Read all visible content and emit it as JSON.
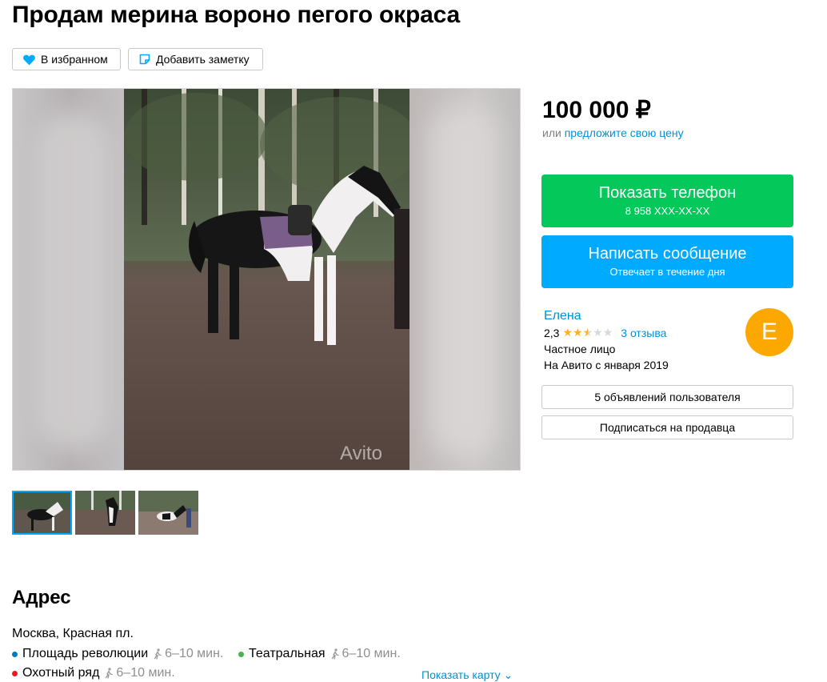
{
  "title": "Продам мерина вороно пегого окраса",
  "actions": {
    "favorite_label": "В избранном",
    "note_label": "Добавить заметку"
  },
  "gallery": {
    "watermark": "Avito",
    "thumbnails": [
      {
        "active": true
      },
      {
        "active": false
      },
      {
        "active": false
      }
    ]
  },
  "price": {
    "value": "100 000 ₽",
    "or_text": "или ",
    "offer_link": "предложите свою цену"
  },
  "buttons": {
    "phone_label": "Показать телефон",
    "phone_number": "8 958 XXX-XX-XX",
    "message_label": "Написать сообщение",
    "message_sub": "Отвечает в течение дня",
    "phone_color": "#04c85a",
    "message_color": "#00aaff"
  },
  "seller": {
    "name": "Елена",
    "rating": "2,3",
    "stars_filled": 2.5,
    "reviews": "3 отзыва",
    "type": "Частное лицо",
    "since": "На Авито с января 2019",
    "avatar_letter": "Е",
    "avatar_color": "#fda800",
    "listings_label": "5 объявлений пользователя",
    "subscribe_label": "Подписаться на продавца"
  },
  "address": {
    "heading": "Адрес",
    "line": "Москва, Красная пл.",
    "stations": [
      {
        "name": "Площадь революции",
        "time": "6–10 мин.",
        "color": "#0078be"
      },
      {
        "name": "Театральная",
        "time": "6–10 мин.",
        "color": "#4fb04f"
      },
      {
        "name": "Охотный ряд",
        "time": "6–10 мин.",
        "color": "#ef161e"
      }
    ],
    "show_map": "Показать карту"
  }
}
